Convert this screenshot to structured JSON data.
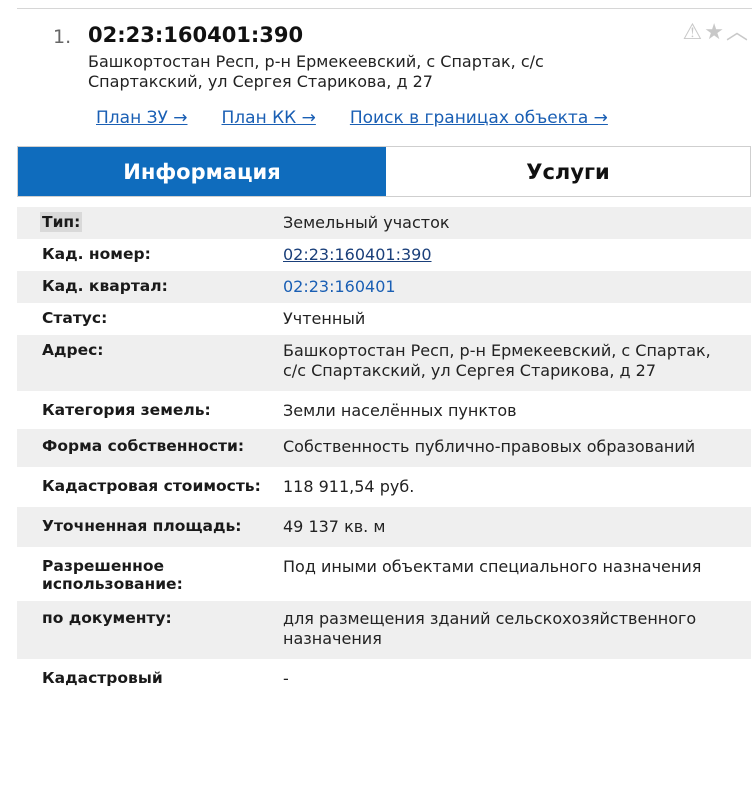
{
  "result": {
    "index": "1.",
    "cadastral_number": "02:23:160401:390",
    "address": "Башкортостан Респ, р-н Ермекеевский, с Спартак, с/с Спартакский, ул Сергея Старикова, д 27",
    "icons": [
      "warning-icon",
      "star-icon",
      "chevron-up-icon"
    ]
  },
  "links": {
    "plan_zu": "План ЗУ →",
    "plan_kk": "План КК →",
    "search": "Поиск в границах объекта →"
  },
  "tabs": {
    "info": "Информация",
    "services": "Услуги",
    "active": "info",
    "active_color": "#0f6cbd"
  },
  "rows": [
    {
      "key": "Тип:",
      "value": "Земельный участок"
    },
    {
      "key": "Кад. номер:",
      "value": "02:23:160401:390"
    },
    {
      "key": "Кад. квартал:",
      "value": "02:23:160401"
    },
    {
      "key": "Статус:",
      "value": "Учтенный"
    },
    {
      "key": "Адрес:",
      "value": "Башкортостан Респ, р-н Ермекеевский, с Спартак, с/с Спартакский, ул Сергея Старикова, д 27"
    },
    {
      "key": "Категория земель:",
      "value": "Земли населённых пунктов"
    },
    {
      "key": "Форма собственности:",
      "value": "Собственность публично-правовых образований"
    },
    {
      "key": "Кадастровая стоимость:",
      "value": "118 911,54 руб."
    },
    {
      "key": "Уточненная площадь:",
      "value": "49 137 кв. м"
    },
    {
      "key": "Разрешенное использование:",
      "value": "Под иными объектами специального назначения"
    },
    {
      "key": "по документу:",
      "value": "для размещения зданий сельскохозяйственного назначения"
    },
    {
      "key": "Кадастровый",
      "value": "-"
    }
  ]
}
